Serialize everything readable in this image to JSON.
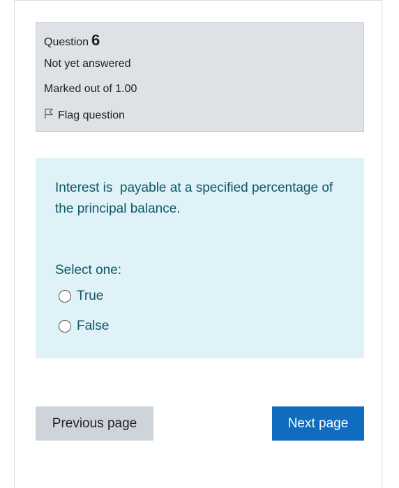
{
  "question_info": {
    "label": "Question",
    "number": "6",
    "status": "Not yet answered",
    "marks": "Marked out of 1.00",
    "flag_label": "Flag question"
  },
  "question": {
    "text": "Interest is  payable at a specified percentage of the principal balance.",
    "prompt": "Select one:",
    "options": [
      {
        "label": "True"
      },
      {
        "label": "False"
      }
    ]
  },
  "navigation": {
    "previous_label": "Previous page",
    "next_label": "Next page"
  },
  "colors": {
    "info_bg": "#dee2e6",
    "question_bg": "#def2f8",
    "question_text": "#115566",
    "next_button": "#0f6cbf",
    "prev_button": "#ced4da"
  }
}
